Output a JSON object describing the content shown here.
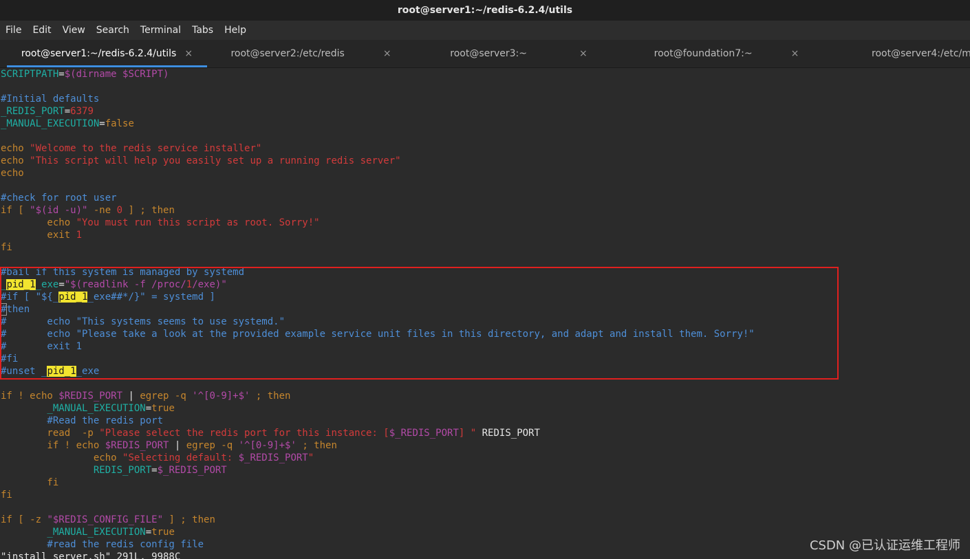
{
  "window": {
    "title": "root@server1:~/redis-6.2.4/utils"
  },
  "menu": [
    "File",
    "Edit",
    "View",
    "Search",
    "Terminal",
    "Tabs",
    "Help"
  ],
  "tabs": [
    {
      "label": "root@server1:~/redis-6.2.4/utils",
      "close": "×",
      "active": true
    },
    {
      "label": "root@server2:/etc/redis",
      "close": "×",
      "active": false
    },
    {
      "label": "root@server3:~",
      "close": "×",
      "active": false
    },
    {
      "label": "root@foundation7:~",
      "close": "×",
      "active": false
    },
    {
      "label": "root@server4:/etc/m",
      "close": "",
      "active": false
    }
  ],
  "colors": {
    "accent": "#3d8ee0",
    "highlight_box": "#e0201f",
    "search_highlight": "#f2e42f"
  },
  "code": {
    "l1a": "SCRIPTPATH",
    "l1b": "=",
    "l1c": "$(dirname $SCRIPT)",
    "l3": "#Initial defaults",
    "l4a": "_REDIS_PORT",
    "l4b": "=",
    "l4c": "6379",
    "l5a": "_MANUAL_EXECUTION",
    "l5b": "=",
    "l5c": "false",
    "l7a": "echo ",
    "l7b": "\"Welcome to the redis service installer\"",
    "l8a": "echo ",
    "l8b": "\"This script will help you easily set up a running redis server\"",
    "l9": "echo",
    "l11": "#check for root user",
    "l12a": "if [ ",
    "l12b": "\"$(id -u)\"",
    "l12c": " -ne ",
    "l12d": "0",
    "l12e": " ] ; then",
    "l13a": "        echo ",
    "l13b": "\"You must run this script as root. Sorry!\"",
    "l14a": "        exit ",
    "l14b": "1",
    "l15": "fi",
    "l17": "#bail if this system is managed by systemd",
    "l18a": "_",
    "l18b": "pid_1",
    "l18c": "_exe",
    "l18d": "=",
    "l18e": "\"$(readlink -f /proc/",
    "l18f": "1",
    "l18g": "/exe)\"",
    "l19a": "#if [ \"${_",
    "l19b": "pid_1",
    "l19c": "_exe##*/}\" = systemd ]",
    "l20a": "#",
    "l20b": "then",
    "l21": "#       echo \"This systems seems to use systemd.\"",
    "l22": "#       echo \"Please take a look at the provided example service unit files in this directory, and adapt and install them. Sorry!\"",
    "l23": "#       exit 1",
    "l24": "#fi",
    "l25a": "#unset _",
    "l25b": "pid_1",
    "l25c": "_exe",
    "l27a": "if ! echo ",
    "l27b": "$REDIS_PORT",
    "l27c": " | ",
    "l27d": "egrep -q ",
    "l27e": "'^[0-9]+$'",
    "l27f": " ; then",
    "l28a": "        _MANUAL_EXECUTION",
    "l28b": "=",
    "l28c": "true",
    "l29": "        #Read the redis port",
    "l30a": "        read  -p ",
    "l30b": "\"Please select the redis port for this instance: [",
    "l30c": "$_REDIS_PORT",
    "l30d": "] \"",
    "l30e": " REDIS_PORT",
    "l31a": "        if ! echo ",
    "l31b": "$REDIS_PORT",
    "l31c": " | ",
    "l31d": "egrep -q ",
    "l31e": "'^[0-9]+$'",
    "l31f": " ; then",
    "l32a": "                echo ",
    "l32b": "\"Selecting default: ",
    "l32c": "$_REDIS_PORT",
    "l32d": "\"",
    "l33a": "                REDIS_PORT",
    "l33b": "=",
    "l33c": "$_REDIS_PORT",
    "l34": "        fi",
    "l35": "fi",
    "l37a": "if [ -z ",
    "l37b": "\"$REDIS_CONFIG_FILE\"",
    "l37c": " ] ; then",
    "l38a": "        _MANUAL_EXECUTION",
    "l38b": "=",
    "l38c": "true",
    "l39": "        #read the redis config file",
    "l40": "\"install_server.sh\" 291L, 9988C"
  },
  "watermark": "CSDN @已认证运维工程师"
}
